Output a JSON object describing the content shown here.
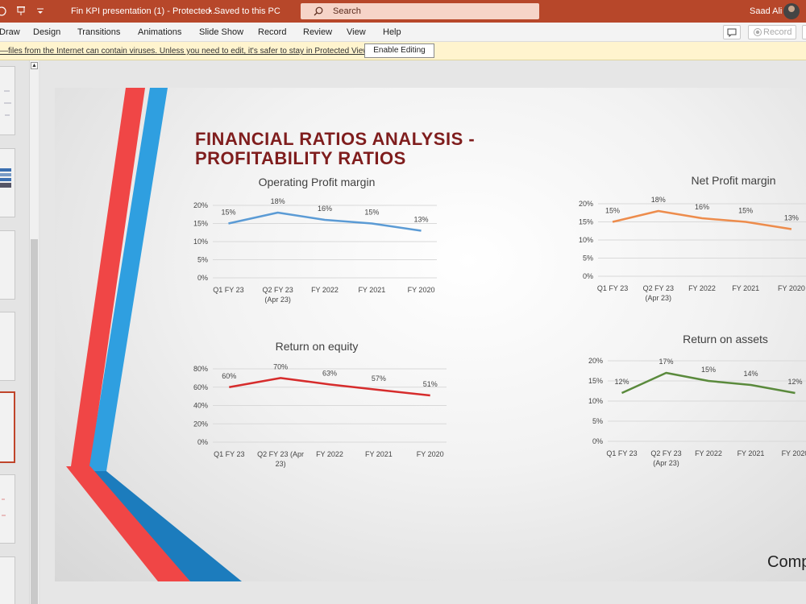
{
  "titlebar": {
    "doc_title": "Fin KPI presentation (1)  -  Protected...",
    "save_status": "•  Saved to this PC",
    "search_placeholder": "Search",
    "user_name": "Saad Ali"
  },
  "ribbon": {
    "tabs": [
      "Draw",
      "Design",
      "Transitions",
      "Animations",
      "Slide Show",
      "Record",
      "Review",
      "View",
      "Help"
    ],
    "record_button": "Record"
  },
  "protected_view": {
    "message": "—files from the Internet can contain viruses. Unless you need to edit, it's safer to stay in Protected View.",
    "enable_button": "Enable Editing"
  },
  "slide": {
    "title_line1": "FINANCIAL RATIOS ANALYSIS -",
    "title_line2": "PROFITABILITY RATIOS",
    "footer_text": "Comp"
  },
  "colors": {
    "titlebar": "#b7472a",
    "slide_title": "#7f1d1d",
    "red_stripe": "#f04646",
    "blue_stripe": "#2f9fe0"
  },
  "chart_data": [
    {
      "type": "line",
      "title": "Operating Profit margin",
      "categories": [
        "Q1 FY 23",
        "Q2 FY 23 (Apr 23)",
        "FY 2022",
        "FY 2021",
        "FY 2020"
      ],
      "values": [
        15,
        18,
        16,
        15,
        13
      ],
      "data_labels": [
        "15%",
        "18%",
        "16%",
        "15%",
        "13%"
      ],
      "ylim": [
        0,
        20
      ],
      "yticks": [
        "0%",
        "5%",
        "10%",
        "15%",
        "20%"
      ],
      "color": "#5b9bd5",
      "grid": true
    },
    {
      "type": "line",
      "title": "Net Profit margin",
      "categories": [
        "Q1 FY 23",
        "Q2 FY 23 (Apr 23)",
        "FY 2022",
        "FY 2021",
        "FY 2020"
      ],
      "values": [
        15,
        18,
        16,
        15,
        13
      ],
      "data_labels": [
        "15%",
        "18%",
        "16%",
        "15%",
        "13%"
      ],
      "ylim": [
        0,
        20
      ],
      "yticks": [
        "0%",
        "5%",
        "10%",
        "15%",
        "20%"
      ],
      "color": "#ed8c4c",
      "grid": true
    },
    {
      "type": "line",
      "title": "Return on equity",
      "categories": [
        "Q1 FY 23",
        "Q2 FY 23 (Apr 23)",
        "FY 2022",
        "FY 2021",
        "FY 2020"
      ],
      "values": [
        60,
        70,
        63,
        57,
        51
      ],
      "data_labels": [
        "60%",
        "70%",
        "63%",
        "57%",
        "51%"
      ],
      "ylim": [
        0,
        80
      ],
      "yticks": [
        "0%",
        "20%",
        "40%",
        "60%",
        "80%"
      ],
      "color": "#d62c2c",
      "grid": true
    },
    {
      "type": "line",
      "title": "Return on assets",
      "categories": [
        "Q1 FY 23",
        "Q2 FY 23 (Apr 23)",
        "FY 2022",
        "FY 2021",
        "FY 2020"
      ],
      "values": [
        12,
        17,
        15,
        14,
        12
      ],
      "data_labels": [
        "12%",
        "17%",
        "15%",
        "14%",
        "12%"
      ],
      "ylim": [
        0,
        20
      ],
      "yticks": [
        "0%",
        "5%",
        "10%",
        "15%",
        "20%"
      ],
      "color": "#5a8a3c",
      "grid": true
    }
  ]
}
